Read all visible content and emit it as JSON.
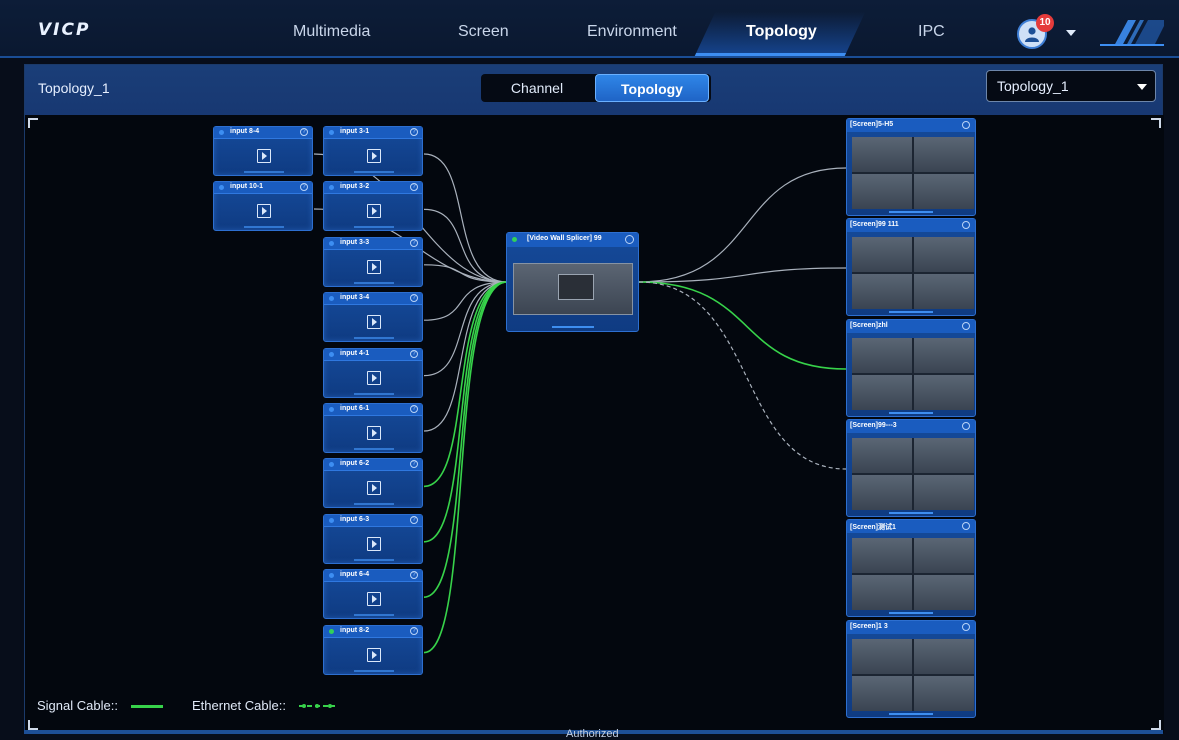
{
  "app": {
    "logo": "VICP"
  },
  "nav": {
    "tabs": [
      {
        "label": "Multimedia",
        "active": false
      },
      {
        "label": "Screen",
        "active": false
      },
      {
        "label": "Environment",
        "active": false
      },
      {
        "label": "Topology",
        "active": true
      },
      {
        "label": "IPC",
        "active": false
      }
    ],
    "notification_count": "10",
    "user_icon": "user-avatar-icon"
  },
  "panel": {
    "title": "Topology_1",
    "mode_switch": {
      "channel_label": "Channel",
      "topology_label": "Topology",
      "selected": "Topology"
    },
    "topology_select": {
      "value": "Topology_1"
    }
  },
  "topology": {
    "sources_col1": [
      {
        "label": "input 8-4",
        "online": false
      },
      {
        "label": "input 10-1",
        "online": false
      }
    ],
    "sources_col2": [
      {
        "label": "input 3-1",
        "online": false
      },
      {
        "label": "input 3-2",
        "online": false
      },
      {
        "label": "input 3-3",
        "online": false
      },
      {
        "label": "input 3-4",
        "online": false
      },
      {
        "label": "input 4-1",
        "online": false
      },
      {
        "label": "input 6-1",
        "online": false
      },
      {
        "label": "input 6-2",
        "online": false
      },
      {
        "label": "input 6-3",
        "online": false
      },
      {
        "label": "input 6-4",
        "online": false
      },
      {
        "label": "input 8-2",
        "online": true
      }
    ],
    "splicer": {
      "label": "[Video Wall Splicer]  99",
      "online": true
    },
    "screens": [
      {
        "label": "[Screen]5-H5"
      },
      {
        "label": "[Screen]99    111"
      },
      {
        "label": "[Screen]zhl"
      },
      {
        "label": "[Screen]99---3"
      },
      {
        "label": "[Screen]测试1"
      },
      {
        "label": "[Screen]1    3"
      }
    ],
    "colors": {
      "signal": "#37d24a",
      "default_link": "#a9b1bc",
      "node_bg": "#0f3b82",
      "accent": "#3d8ef2"
    }
  },
  "legend": {
    "signal_label": "Signal Cable::",
    "ethernet_label": "Ethernet Cable::"
  },
  "footer": {
    "status": "Authorized"
  }
}
